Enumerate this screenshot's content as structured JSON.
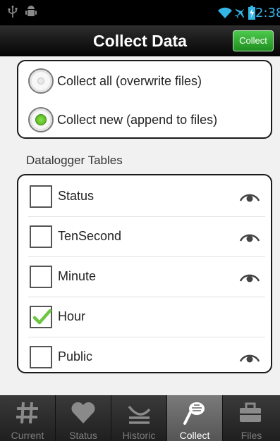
{
  "status_bar": {
    "time": "2:38",
    "icons": [
      "usb-icon",
      "android-debug-icon",
      "wifi-icon",
      "airplane-icon",
      "battery-charging-icon"
    ],
    "icon_color": "#33b5e5"
  },
  "title_bar": {
    "title": "Collect Data",
    "collect_button": "Collect"
  },
  "collect_mode": {
    "options": [
      {
        "label": "Collect all (overwrite files)",
        "selected": false
      },
      {
        "label": "Collect new (append to files)",
        "selected": true
      }
    ]
  },
  "tables_section": {
    "heading": "Datalogger Tables",
    "tables": [
      {
        "name": "Status",
        "checked": false,
        "has_view": true
      },
      {
        "name": "TenSecond",
        "checked": false,
        "has_view": true
      },
      {
        "name": "Minute",
        "checked": false,
        "has_view": true
      },
      {
        "name": "Hour",
        "checked": true,
        "has_view": false
      },
      {
        "name": "Public",
        "checked": false,
        "has_view": true
      }
    ]
  },
  "tabs": [
    {
      "label": "Current",
      "icon": "hash-icon",
      "active": false
    },
    {
      "label": "Status",
      "icon": "heart-icon",
      "active": false
    },
    {
      "label": "Historic",
      "icon": "historic-chart-icon",
      "active": false
    },
    {
      "label": "Collect",
      "icon": "collect-net-icon",
      "active": true
    },
    {
      "label": "Files",
      "icon": "briefcase-icon",
      "active": false
    }
  ],
  "colors": {
    "accent_green": "#2aa52a",
    "check_green": "#6cc644"
  }
}
